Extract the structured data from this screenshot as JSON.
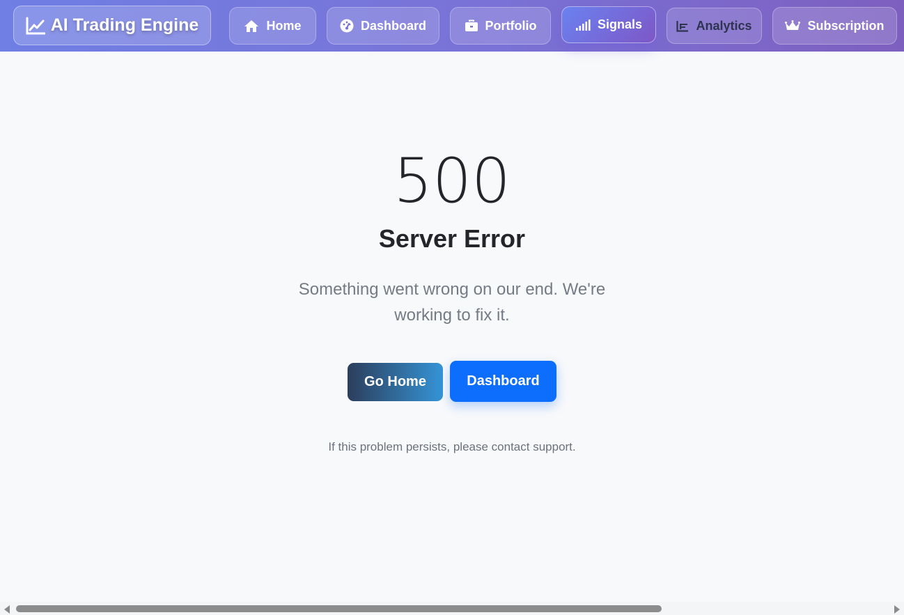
{
  "navbar": {
    "brand": {
      "label": "AI Trading Engine",
      "icon": "chart-line-icon"
    },
    "items": [
      {
        "label": "Home",
        "icon": "home-icon"
      },
      {
        "label": "Dashboard",
        "icon": "gauge-icon"
      },
      {
        "label": "Portfolio",
        "icon": "briefcase-icon"
      },
      {
        "label": "Signals",
        "icon": "signal-bars-icon",
        "active": true
      },
      {
        "label": "Analytics",
        "icon": "chart-area-icon"
      },
      {
        "label": "Subscription",
        "icon": "crown-icon"
      }
    ]
  },
  "error": {
    "code": "500",
    "title": "Server Error",
    "message": "Something went wrong on our end. We're working to fix it.",
    "support_note": "If this problem persists, please contact support."
  },
  "actions": {
    "home_label": "Go Home",
    "dashboard_label": "Dashboard"
  },
  "colors": {
    "nav_gradient_start": "#6f7fe4",
    "nav_gradient_end": "#7d5fbf",
    "primary_button": "#0d6efd",
    "home_button_start": "#2c3e5c",
    "home_button_end": "#3594d6"
  }
}
